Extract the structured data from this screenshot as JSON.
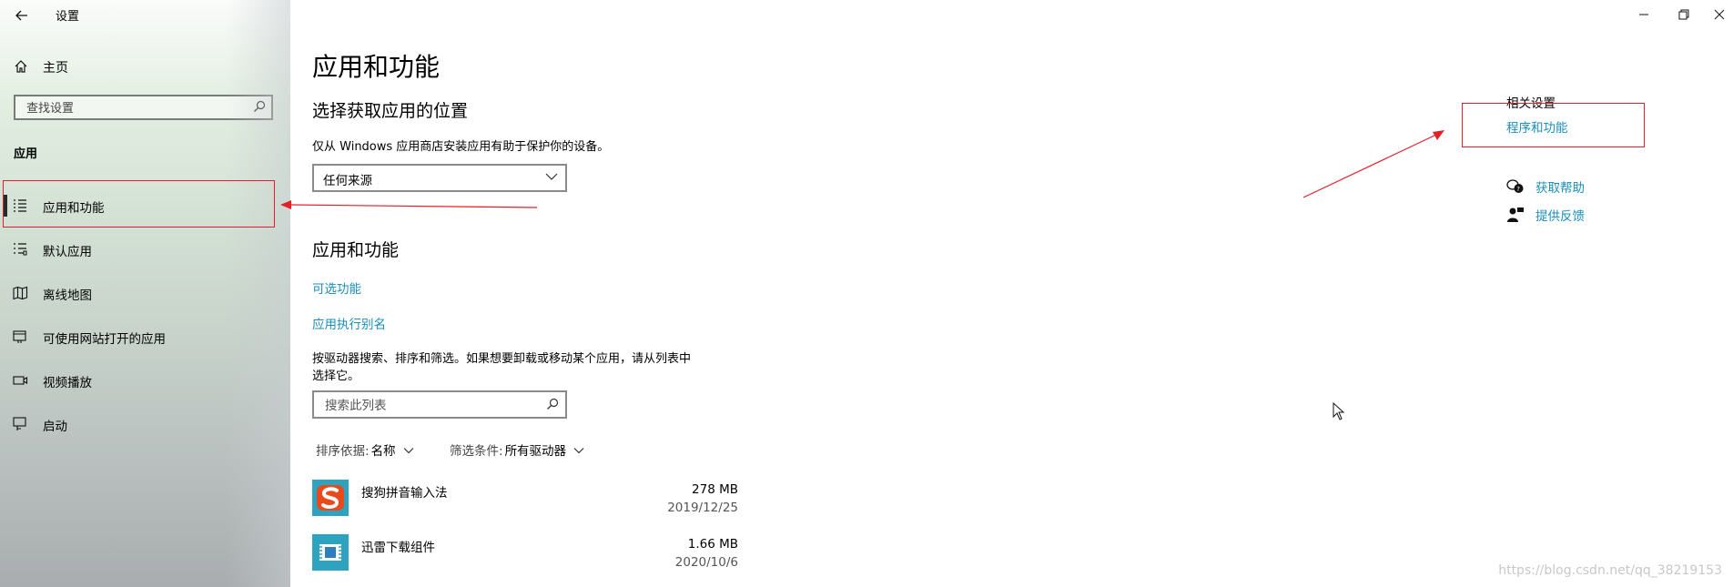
{
  "window": {
    "title": "设置",
    "controls": {
      "minimize": "minimize-icon",
      "restore": "restore-icon",
      "close": "close-icon"
    }
  },
  "sidebar": {
    "home_label": "主页",
    "search_placeholder": "查找设置",
    "section_label": "应用",
    "items": [
      {
        "label": "应用和功能",
        "icon": "apps-features-icon",
        "active": true
      },
      {
        "label": "默认应用",
        "icon": "default-apps-icon",
        "active": false
      },
      {
        "label": "离线地图",
        "icon": "offline-maps-icon",
        "active": false
      },
      {
        "label": "可使用网站打开的应用",
        "icon": "apps-for-websites-icon",
        "active": false
      },
      {
        "label": "视频播放",
        "icon": "video-playback-icon",
        "active": false
      },
      {
        "label": "启动",
        "icon": "startup-icon",
        "active": false
      }
    ]
  },
  "main": {
    "page_title": "应用和功能",
    "install_section": {
      "heading": "选择获取应用的位置",
      "description": "仅从 Windows 应用商店安装应用有助于保护你的设备。",
      "dropdown_value": "任何来源"
    },
    "apps_section": {
      "heading": "应用和功能",
      "optional_features_link": "可选功能",
      "aliases_link": "应用执行别名",
      "description_line1": "按驱动器搜索、排序和筛选。如果想要卸载或移动某个应用，请从列表中",
      "description_line2": "选择它。",
      "search_placeholder": "搜索此列表",
      "sort_label": "排序依据:",
      "sort_value": "名称",
      "filter_label": "筛选条件:",
      "filter_value": "所有驱动器",
      "apps": [
        {
          "name": "搜狗拼音输入法",
          "size": "278 MB",
          "date": "2019/12/25",
          "icon": "sogou-icon"
        },
        {
          "name": "迅雷下载组件",
          "size": "1.66 MB",
          "date": "2020/10/6",
          "icon": "thunder-icon"
        }
      ]
    },
    "related": {
      "title": "相关设置",
      "programs_link": "程序和功能",
      "help_link": "获取帮助",
      "feedback_link": "提供反馈"
    }
  },
  "colors": {
    "link": "#0067c0",
    "annotation": "#e0202a"
  },
  "watermark": "https://blog.csdn.net/qq_38219153"
}
